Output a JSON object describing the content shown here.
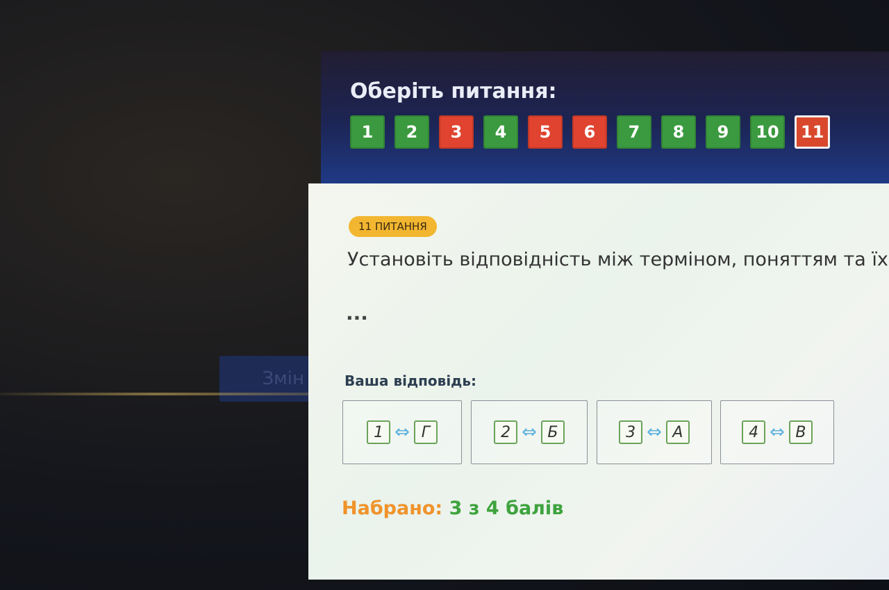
{
  "background": {
    "button_text": "Змін"
  },
  "header": {
    "title": "Оберіть питання:",
    "questions": [
      {
        "label": "1",
        "status": "correct"
      },
      {
        "label": "2",
        "status": "correct"
      },
      {
        "label": "3",
        "status": "wrong"
      },
      {
        "label": "4",
        "status": "correct"
      },
      {
        "label": "5",
        "status": "wrong"
      },
      {
        "label": "6",
        "status": "wrong"
      },
      {
        "label": "7",
        "status": "correct"
      },
      {
        "label": "8",
        "status": "correct"
      },
      {
        "label": "9",
        "status": "correct"
      },
      {
        "label": "10",
        "status": "correct"
      },
      {
        "label": "11",
        "status": "current"
      }
    ]
  },
  "question": {
    "badge": "11 ПИТАННЯ",
    "text": "Установіть відповідність між терміном, поняттям та їх визн",
    "ellipsis": "..."
  },
  "answer": {
    "label": "Ваша відповідь:",
    "arrow_glyph": "⇔",
    "pairs": [
      {
        "left": "1",
        "right": "Г"
      },
      {
        "left": "2",
        "right": "Б"
      },
      {
        "left": "3",
        "right": "А"
      },
      {
        "left": "4",
        "right": "В"
      }
    ]
  },
  "score": {
    "label": "Набрано:",
    "value": "3 з 4 балів"
  },
  "colors": {
    "correct": "#3b9a3f",
    "wrong": "#e0432f",
    "badge": "#f2b630",
    "score_label": "#f0932b",
    "score_value": "#3ea33e"
  }
}
